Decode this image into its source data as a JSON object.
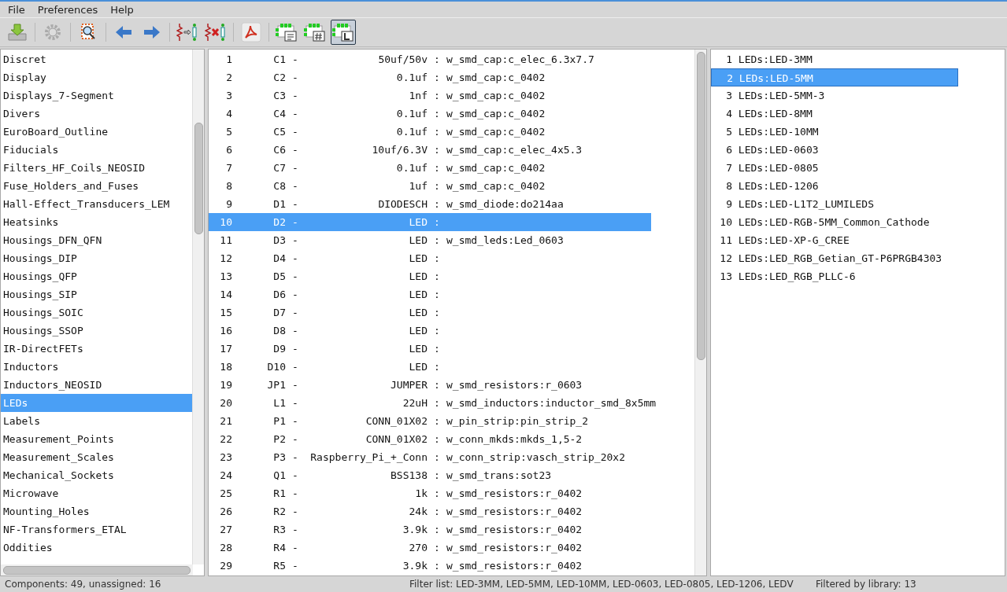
{
  "menu": [
    "File",
    "Preferences",
    "Help"
  ],
  "toolbar": [
    {
      "kind": "save"
    },
    {
      "kind": "sep"
    },
    {
      "kind": "settings"
    },
    {
      "kind": "sep"
    },
    {
      "kind": "view"
    },
    {
      "kind": "sep"
    },
    {
      "kind": "prev"
    },
    {
      "kind": "next"
    },
    {
      "kind": "sep"
    },
    {
      "kind": "assign"
    },
    {
      "kind": "delete"
    },
    {
      "kind": "sep"
    },
    {
      "kind": "pdf"
    },
    {
      "kind": "sep"
    },
    {
      "kind": "filter-keyword",
      "selected": false
    },
    {
      "kind": "filter-pins",
      "selected": false
    },
    {
      "kind": "filter-library",
      "selected": true
    }
  ],
  "libraries": [
    {
      "name": "Discret",
      "selected": false
    },
    {
      "name": "Display",
      "selected": false
    },
    {
      "name": "Displays_7-Segment",
      "selected": false
    },
    {
      "name": "Divers",
      "selected": false
    },
    {
      "name": "EuroBoard_Outline",
      "selected": false
    },
    {
      "name": "Fiducials",
      "selected": false
    },
    {
      "name": "Filters_HF_Coils_NEOSID",
      "selected": false
    },
    {
      "name": "Fuse_Holders_and_Fuses",
      "selected": false
    },
    {
      "name": "Hall-Effect_Transducers_LEM",
      "selected": false
    },
    {
      "name": "Heatsinks",
      "selected": false
    },
    {
      "name": "Housings_DFN_QFN",
      "selected": false
    },
    {
      "name": "Housings_DIP",
      "selected": false
    },
    {
      "name": "Housings_QFP",
      "selected": false
    },
    {
      "name": "Housings_SIP",
      "selected": false
    },
    {
      "name": "Housings_SOIC",
      "selected": false
    },
    {
      "name": "Housings_SSOP",
      "selected": false
    },
    {
      "name": "IR-DirectFETs",
      "selected": false
    },
    {
      "name": "Inductors",
      "selected": false
    },
    {
      "name": "Inductors_NEOSID",
      "selected": false
    },
    {
      "name": "LEDs",
      "selected": true
    },
    {
      "name": "Labels",
      "selected": false
    },
    {
      "name": "Measurement_Points",
      "selected": false
    },
    {
      "name": "Measurement_Scales",
      "selected": false
    },
    {
      "name": "Mechanical_Sockets",
      "selected": false
    },
    {
      "name": "Microwave",
      "selected": false
    },
    {
      "name": "Mounting_Holes",
      "selected": false
    },
    {
      "name": "NF-Transformers_ETAL",
      "selected": false
    },
    {
      "name": "Oddities",
      "selected": false
    }
  ],
  "components": [
    {
      "num": "1",
      "ref": "C1",
      "dash": "-",
      "value": "50uf/50v",
      "colon": ":",
      "footprint": "w_smd_cap:c_elec_6.3x7.7",
      "selected": false
    },
    {
      "num": "2",
      "ref": "C2",
      "dash": "-",
      "value": "0.1uf",
      "colon": ":",
      "footprint": "w_smd_cap:c_0402",
      "selected": false
    },
    {
      "num": "3",
      "ref": "C3",
      "dash": "-",
      "value": "1nf",
      "colon": ":",
      "footprint": "w_smd_cap:c_0402",
      "selected": false
    },
    {
      "num": "4",
      "ref": "C4",
      "dash": "-",
      "value": "0.1uf",
      "colon": ":",
      "footprint": "w_smd_cap:c_0402",
      "selected": false
    },
    {
      "num": "5",
      "ref": "C5",
      "dash": "-",
      "value": "0.1uf",
      "colon": ":",
      "footprint": "w_smd_cap:c_0402",
      "selected": false
    },
    {
      "num": "6",
      "ref": "C6",
      "dash": "-",
      "value": "10uf/6.3V",
      "colon": ":",
      "footprint": "w_smd_cap:c_elec_4x5.3",
      "selected": false
    },
    {
      "num": "7",
      "ref": "C7",
      "dash": "-",
      "value": "0.1uf",
      "colon": ":",
      "footprint": "w_smd_cap:c_0402",
      "selected": false
    },
    {
      "num": "8",
      "ref": "C8",
      "dash": "-",
      "value": "1uf",
      "colon": ":",
      "footprint": "w_smd_cap:c_0402",
      "selected": false
    },
    {
      "num": "9",
      "ref": "D1",
      "dash": "-",
      "value": "DIODESCH",
      "colon": ":",
      "footprint": "w_smd_diode:do214aa",
      "selected": false
    },
    {
      "num": "10",
      "ref": "D2",
      "dash": "-",
      "value": "LED",
      "colon": ":",
      "selected": true
    },
    {
      "num": "11",
      "ref": "D3",
      "dash": "-",
      "value": "LED",
      "colon": ":",
      "footprint": "w_smd_leds:Led_0603",
      "selected": false
    },
    {
      "num": "12",
      "ref": "D4",
      "dash": "-",
      "value": "LED",
      "colon": ":",
      "selected": false
    },
    {
      "num": "13",
      "ref": "D5",
      "dash": "-",
      "value": "LED",
      "colon": ":",
      "selected": false
    },
    {
      "num": "14",
      "ref": "D6",
      "dash": "-",
      "value": "LED",
      "colon": ":",
      "selected": false
    },
    {
      "num": "15",
      "ref": "D7",
      "dash": "-",
      "value": "LED",
      "colon": ":",
      "selected": false
    },
    {
      "num": "16",
      "ref": "D8",
      "dash": "-",
      "value": "LED",
      "colon": ":",
      "selected": false
    },
    {
      "num": "17",
      "ref": "D9",
      "dash": "-",
      "value": "LED",
      "colon": ":",
      "selected": false
    },
    {
      "num": "18",
      "ref": "D10",
      "dash": "-",
      "value": "LED",
      "colon": ":",
      "selected": false
    },
    {
      "num": "19",
      "ref": "JP1",
      "dash": "-",
      "value": "JUMPER",
      "colon": ":",
      "footprint": "w_smd_resistors:r_0603",
      "selected": false
    },
    {
      "num": "20",
      "ref": "L1",
      "dash": "-",
      "value": "22uH",
      "colon": ":",
      "footprint": "w_smd_inductors:inductor_smd_8x5mm",
      "selected": false
    },
    {
      "num": "21",
      "ref": "P1",
      "dash": "-",
      "value": "CONN_01X02",
      "colon": ":",
      "footprint": "w_pin_strip:pin_strip_2",
      "selected": false
    },
    {
      "num": "22",
      "ref": "P2",
      "dash": "-",
      "value": "CONN_01X02",
      "colon": ":",
      "footprint": "w_conn_mkds:mkds_1,5-2",
      "selected": false
    },
    {
      "num": "23",
      "ref": "P3",
      "dash": "-",
      "value": "Raspberry_Pi_+_Conn",
      "colon": ":",
      "footprint": "w_conn_strip:vasch_strip_20x2",
      "selected": false
    },
    {
      "num": "24",
      "ref": "Q1",
      "dash": "-",
      "value": "BSS138",
      "colon": ":",
      "footprint": "w_smd_trans:sot23",
      "selected": false
    },
    {
      "num": "25",
      "ref": "R1",
      "dash": "-",
      "value": "1k",
      "colon": ":",
      "footprint": "w_smd_resistors:r_0402",
      "selected": false
    },
    {
      "num": "26",
      "ref": "R2",
      "dash": "-",
      "value": "24k",
      "colon": ":",
      "footprint": "w_smd_resistors:r_0402",
      "selected": false
    },
    {
      "num": "27",
      "ref": "R3",
      "dash": "-",
      "value": "3.9k",
      "colon": ":",
      "footprint": "w_smd_resistors:r_0402",
      "selected": false
    },
    {
      "num": "28",
      "ref": "R4",
      "dash": "-",
      "value": "270",
      "colon": ":",
      "footprint": "w_smd_resistors:r_0402",
      "selected": false
    },
    {
      "num": "29",
      "ref": "R5",
      "dash": "-",
      "value": "3.9k",
      "colon": ":",
      "footprint": "w_smd_resistors:r_0402",
      "selected": false
    }
  ],
  "footprints": [
    {
      "num": "1",
      "name": "LEDs:LED-3MM",
      "selected": false
    },
    {
      "num": "2",
      "name": "LEDs:LED-5MM",
      "selected": true
    },
    {
      "num": "3",
      "name": "LEDs:LED-5MM-3",
      "selected": false
    },
    {
      "num": "4",
      "name": "LEDs:LED-8MM",
      "selected": false
    },
    {
      "num": "5",
      "name": "LEDs:LED-10MM",
      "selected": false
    },
    {
      "num": "6",
      "name": "LEDs:LED-0603",
      "selected": false
    },
    {
      "num": "7",
      "name": "LEDs:LED-0805",
      "selected": false
    },
    {
      "num": "8",
      "name": "LEDs:LED-1206",
      "selected": false
    },
    {
      "num": "9",
      "name": "LEDs:LED-L1T2_LUMILEDS",
      "selected": false
    },
    {
      "num": "10",
      "name": "LEDs:LED-RGB-5MM_Common_Cathode",
      "selected": false
    },
    {
      "num": "11",
      "name": "LEDs:LED-XP-G_CREE",
      "selected": false
    },
    {
      "num": "12",
      "name": "LEDs:LED_RGB_Getian_GT-P6PRGB4303",
      "selected": false
    },
    {
      "num": "13",
      "name": "LEDs:LED_RGB_PLLC-6",
      "selected": false
    }
  ],
  "status_bar": {
    "components": "Components: 49, unassigned: 16",
    "filter": "Filter list: LED-3MM, LED-5MM, LED-10MM, LED-0603, LED-0805, LED-1206, LEDV",
    "library": "Filtered by library: 13"
  }
}
